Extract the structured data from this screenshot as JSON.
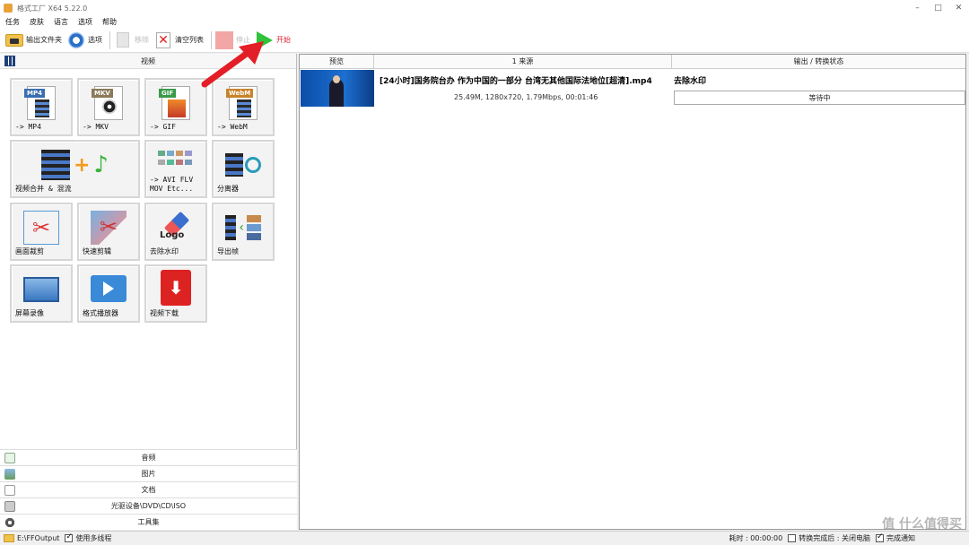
{
  "window": {
    "title": "格式工厂 X64 5.22.0",
    "controls": [
      "–",
      "□",
      "✕"
    ]
  },
  "menu": [
    "任务",
    "皮肤",
    "语言",
    "选项",
    "帮助"
  ],
  "toolbar": {
    "output_folder": "输出文件夹",
    "options": "选项",
    "remove": "移除",
    "clear_list": "清空列表",
    "stop": "停止",
    "start": "开始"
  },
  "left_panel": {
    "active_category": "视频",
    "tiles": [
      {
        "label": "-> MP4",
        "tag": "MP4",
        "tag_color": "#3a6fb0"
      },
      {
        "label": "-> MKV",
        "tag": "MKV",
        "tag_color": "#8a7a5a"
      },
      {
        "label": "-> GIF",
        "tag": "GIF",
        "tag_color": "#3a9a4a"
      },
      {
        "label": "-> WebM",
        "tag": "WebM",
        "tag_color": "#c8832a"
      },
      {
        "label": "视频合并 & 混流"
      },
      {
        "label": "-> AVI FLV\nMOV Etc..."
      },
      {
        "label": "分离器"
      },
      {
        "label": "画面裁剪"
      },
      {
        "label": "快速剪辑"
      },
      {
        "label": "去除水印",
        "logo_text": "Logo"
      },
      {
        "label": "导出帧"
      },
      {
        "label": "屏幕录像"
      },
      {
        "label": "格式播放器"
      },
      {
        "label": "视频下载"
      }
    ],
    "bottom_categories": [
      "音频",
      "图片",
      "文档",
      "光驱设备\\DVD\\CD\\ISO",
      "工具集"
    ]
  },
  "table": {
    "columns": [
      "预览",
      "1 来源",
      "输出 / 转换状态"
    ],
    "rows": [
      {
        "filename": "[24小时]国务院台办 作为中国的一部分 台湾无其他国际法地位[超清].mp4",
        "info": "25.49M, 1280x720, 1.79Mbps, 00:01:46",
        "operation": "去除水印",
        "status": "等待中"
      }
    ]
  },
  "statusbar": {
    "output_path": "E:\\FFOutput",
    "multithread_label": "使用多线程",
    "elapsed": "耗时 : 00:00:00",
    "after_convert_label": "转换完成后 : 关闭电脑",
    "notify_label": "完成通知"
  },
  "watermark": "值 什么值得买"
}
